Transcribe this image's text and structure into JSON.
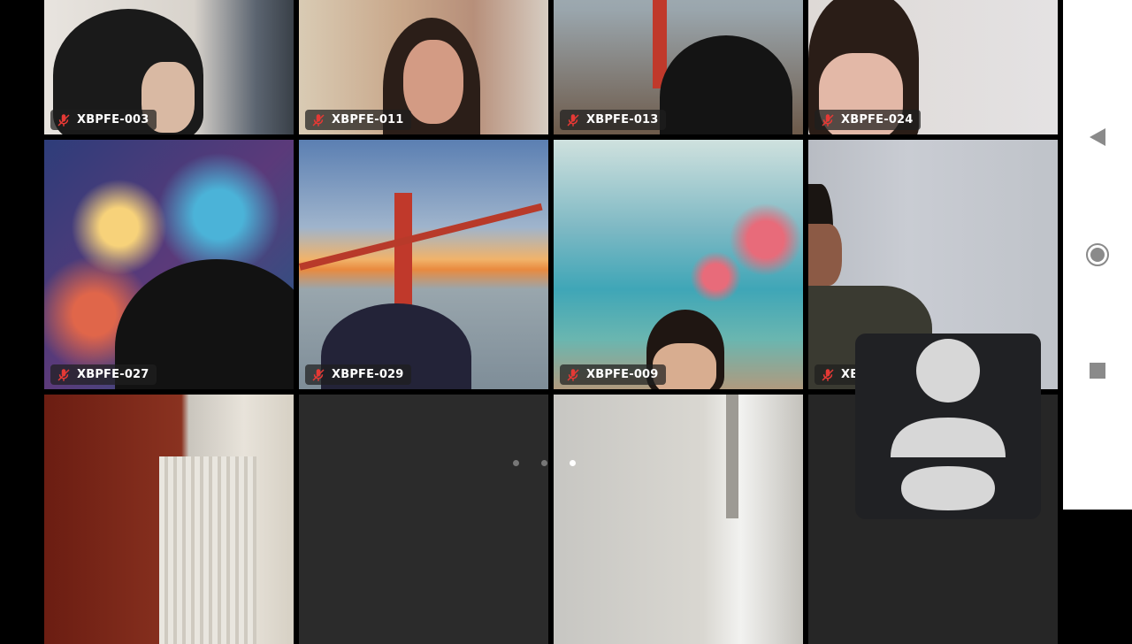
{
  "participants": [
    {
      "name": "XBPFE-003",
      "muted": true
    },
    {
      "name": "XBPFE-011",
      "muted": true
    },
    {
      "name": "XBPFE-013",
      "muted": true
    },
    {
      "name": "XBPFE-024",
      "muted": true
    },
    {
      "name": "XBPFE-027",
      "muted": true
    },
    {
      "name": "XBPFE-029",
      "muted": true
    },
    {
      "name": "XBPFE-009",
      "muted": true
    },
    {
      "name": "XB",
      "muted": true
    }
  ],
  "pagination": {
    "total": 3,
    "active_index": 2
  },
  "icons": {
    "mic_off": "mic-off-icon",
    "back": "back-triangle-icon",
    "home": "home-circle-icon",
    "recents": "recents-square-icon",
    "avatar": "person-placeholder-icon"
  },
  "colors": {
    "mic_off_red": "#e53935",
    "tile_dark": "#202124",
    "nav_bar": "#ffffff"
  }
}
